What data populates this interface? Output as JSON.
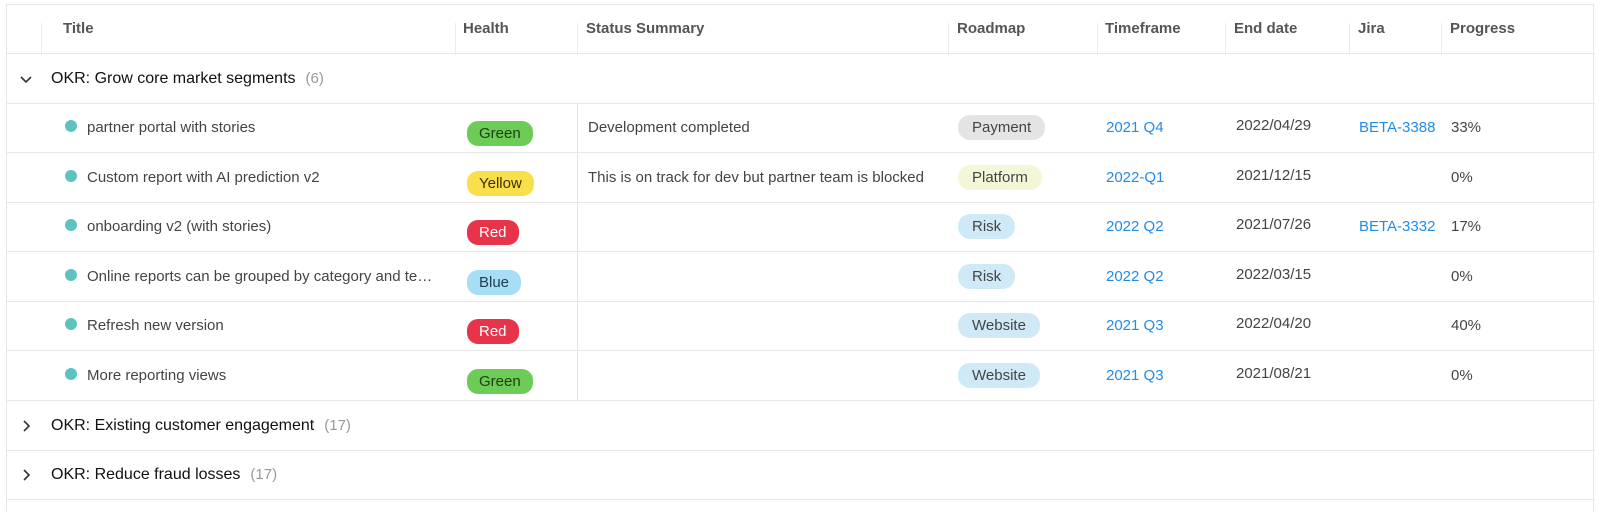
{
  "columns": {
    "title": "Title",
    "health": "Health",
    "status": "Status Summary",
    "roadmap": "Roadmap",
    "timeframe": "Timeframe",
    "end_date": "End date",
    "jira": "Jira",
    "progress": "Progress"
  },
  "groups": [
    {
      "title": "OKR: Grow core market segments",
      "count": "(6)",
      "expanded": true
    },
    {
      "title": "OKR: Existing customer engagement",
      "count": "(17)",
      "expanded": false
    },
    {
      "title": "OKR: Reduce fraud losses",
      "count": "(17)",
      "expanded": false
    }
  ],
  "rows": [
    {
      "title": "partner portal with stories",
      "health": "Green",
      "status": "Development completed",
      "roadmap": "Payment",
      "timeframe": "2021 Q4",
      "end_date": "2022/04/29",
      "jira": "BETA-3388",
      "progress": "33%"
    },
    {
      "title": "Custom report with AI prediction v2",
      "health": "Yellow",
      "status": "This is on track for dev but partner team is blocked",
      "roadmap": "Platform",
      "timeframe": "2022-Q1",
      "end_date": "2021/12/15",
      "jira": "",
      "progress": "0%"
    },
    {
      "title": "onboarding v2 (with stories)",
      "health": "Red",
      "status": "",
      "roadmap": "Risk",
      "timeframe": "2022 Q2",
      "end_date": "2021/07/26",
      "jira": "BETA-3332",
      "progress": "17%"
    },
    {
      "title": "Online reports can be grouped by category and te…",
      "health": "Blue",
      "status": "",
      "roadmap": "Risk",
      "timeframe": "2022 Q2",
      "end_date": "2022/03/15",
      "jira": "",
      "progress": "0%"
    },
    {
      "title": "Refresh new version",
      "health": "Red",
      "status": "",
      "roadmap": "Website",
      "timeframe": "2021 Q3",
      "end_date": "2022/04/20",
      "jira": "",
      "progress": "40%"
    },
    {
      "title": "More reporting views",
      "health": "Green",
      "status": "",
      "roadmap": "Website",
      "timeframe": "2021 Q3",
      "end_date": "2021/08/21",
      "jira": "",
      "progress": "0%"
    }
  ],
  "colors": {
    "health": {
      "Green": "#6ccc55",
      "Yellow": "#f9df4a",
      "Red": "#e8344a",
      "Blue": "#a6def5"
    },
    "health_text": {
      "Green": "#1f3b17",
      "Yellow": "#3a3000",
      "Red": "#ffffff",
      "Blue": "#1d3f4d"
    },
    "roadmap": {
      "Payment": "#e4e4e4",
      "Platform": "#f4f6d8",
      "Risk": "#cfeaf6",
      "Website": "#cfeaf6"
    },
    "dot": "#5ec2c0",
    "link": "#1f8ceb"
  }
}
